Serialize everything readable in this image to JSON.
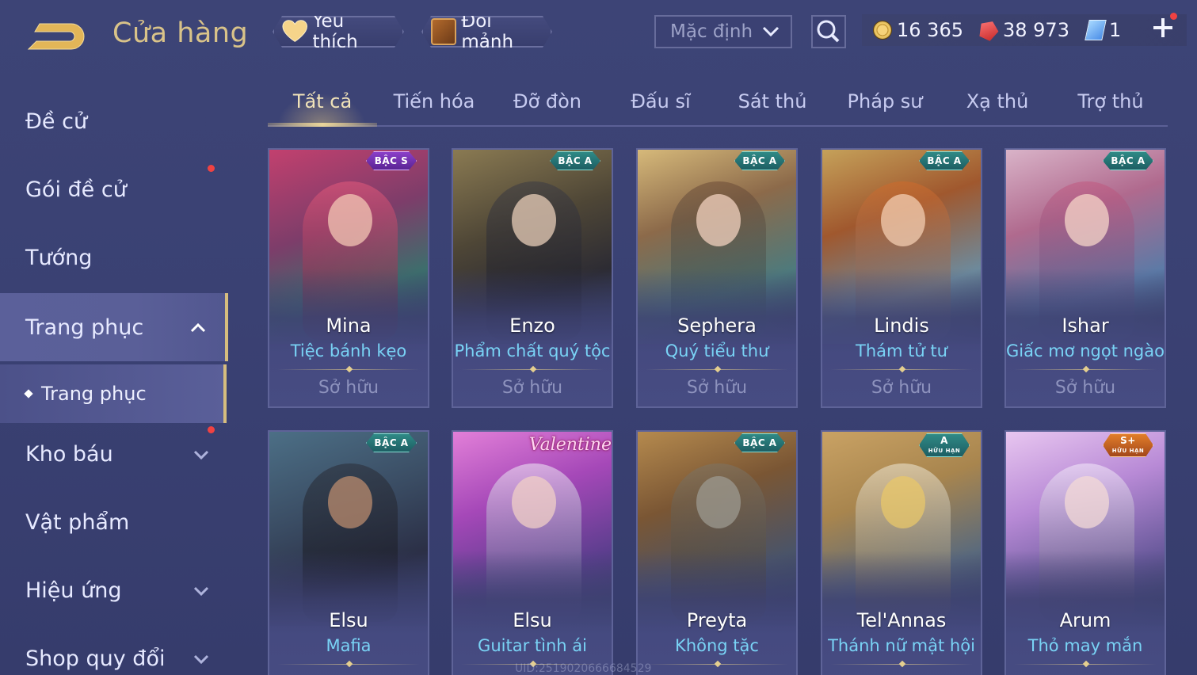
{
  "header": {
    "title": "Cửa hàng",
    "favorites_label": "Yêu thích",
    "exchange_label": "Đổi mảnh",
    "sort_value": "Mặc định",
    "currencies": [
      {
        "icon": "gold-coin-icon",
        "value": "16 365"
      },
      {
        "icon": "ruby-icon",
        "value": "38 973"
      },
      {
        "icon": "voucher-icon",
        "value": "1"
      }
    ]
  },
  "sidebar": {
    "items": [
      {
        "label": "Đề cử"
      },
      {
        "label": "Gói đề cử"
      },
      {
        "label": "Tướng"
      },
      {
        "label": "Trang phục"
      },
      {
        "label": "Trang phục"
      },
      {
        "label": "Kho báu"
      },
      {
        "label": "Vật phẩm"
      },
      {
        "label": "Hiệu ứng"
      },
      {
        "label": "Shop quy đổi"
      }
    ]
  },
  "tabs": [
    "Tất cả",
    "Tiến hóa",
    "Đỡ đòn",
    "Đấu sĩ",
    "Sát thủ",
    "Pháp sư",
    "Xạ thủ",
    "Trợ thủ"
  ],
  "cards": [
    {
      "hero": "Mina",
      "skin": "Tiệc bánh kẹo",
      "status": "Sở hữu",
      "badge": "BẬC S",
      "badge_sub": ""
    },
    {
      "hero": "Enzo",
      "skin": "Phẩm chất quý tộc",
      "status": "Sở hữu",
      "badge": "BẬC A",
      "badge_sub": ""
    },
    {
      "hero": "Sephera",
      "skin": "Quý tiểu thư",
      "status": "Sở hữu",
      "badge": "BẬC A",
      "badge_sub": ""
    },
    {
      "hero": "Lindis",
      "skin": "Thám tử tư",
      "status": "Sở hữu",
      "badge": "BẬC A",
      "badge_sub": ""
    },
    {
      "hero": "Ishar",
      "skin": "Giấc mơ ngọt ngào",
      "status": "Sở hữu",
      "badge": "BẬC A",
      "badge_sub": ""
    },
    {
      "hero": "Elsu",
      "skin": "Mafia",
      "status": "",
      "badge": "BẬC A",
      "badge_sub": ""
    },
    {
      "hero": "Elsu",
      "skin": "Guitar tình ái",
      "status": "",
      "badge": "",
      "badge_sub": "",
      "logo_text": "Valentine"
    },
    {
      "hero": "Preyta",
      "skin": "Không tặc",
      "status": "",
      "badge": "BẬC A",
      "badge_sub": ""
    },
    {
      "hero": "Tel'Annas",
      "skin": "Thánh nữ mật hội",
      "status": "",
      "badge": "A",
      "badge_sub": "HỮU HẠN"
    },
    {
      "hero": "Arum",
      "skin": "Thỏ may mắn",
      "status": "",
      "badge": "S+",
      "badge_sub": "HỮU HẠN"
    }
  ],
  "watermark": "UID:2519020666684529",
  "colors": {
    "accent_gold": "#d9c389",
    "skin_name": "#79d3f5",
    "notification": "#f04242"
  }
}
